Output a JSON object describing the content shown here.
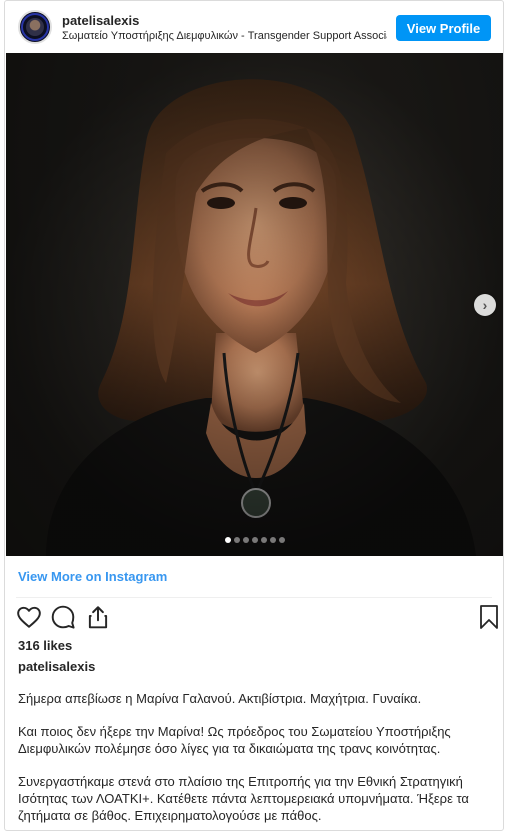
{
  "post": {
    "username": "patelisalexis",
    "subtitle": "Σωματείο Υποστήριξης Διεμφυλικών - Transgender Support Association",
    "view_profile": "View Profile",
    "view_more": "View More on Instagram",
    "likes": "316 likes",
    "caption_user": "patelisalexis",
    "caption_paragraphs": [
      "Σήμερα απεβίωσε η Μαρίνα Γαλανού. Ακτιβίστρια. Μαχήτρια. Γυναίκα.",
      "Και ποιος δεν ήξερε την Μαρίνα! Ως πρόεδρος του Σωματείου Υποστήριξης Διεμφυλικών πολέμησε όσο λίγες για τα δικαιώματα της τρανς κοινότητας.",
      "Συνεργαστήκαμε στενά στο πλαίσιο της Επιτροπής για την Εθνική Στρατηγική Ισότητας των ΛΟΑΤΚΙ+. Κατέθετε πάντα λεπτομερειακά υπομνήματα. Ήξερε τα ζητήματα σε βάθος. Επιχειρηματολογούσε με πάθος."
    ],
    "carousel": {
      "count": 7,
      "active_index": 0
    },
    "next_icon": "›"
  },
  "colors": {
    "button_blue": "#0095f6",
    "link_blue": "#3897f0",
    "text": "#262626",
    "photo_background": "#2a2824"
  },
  "icons": [
    "heart-icon",
    "comment-icon",
    "share-icon",
    "bookmark-icon",
    "chevron-right-icon"
  ]
}
